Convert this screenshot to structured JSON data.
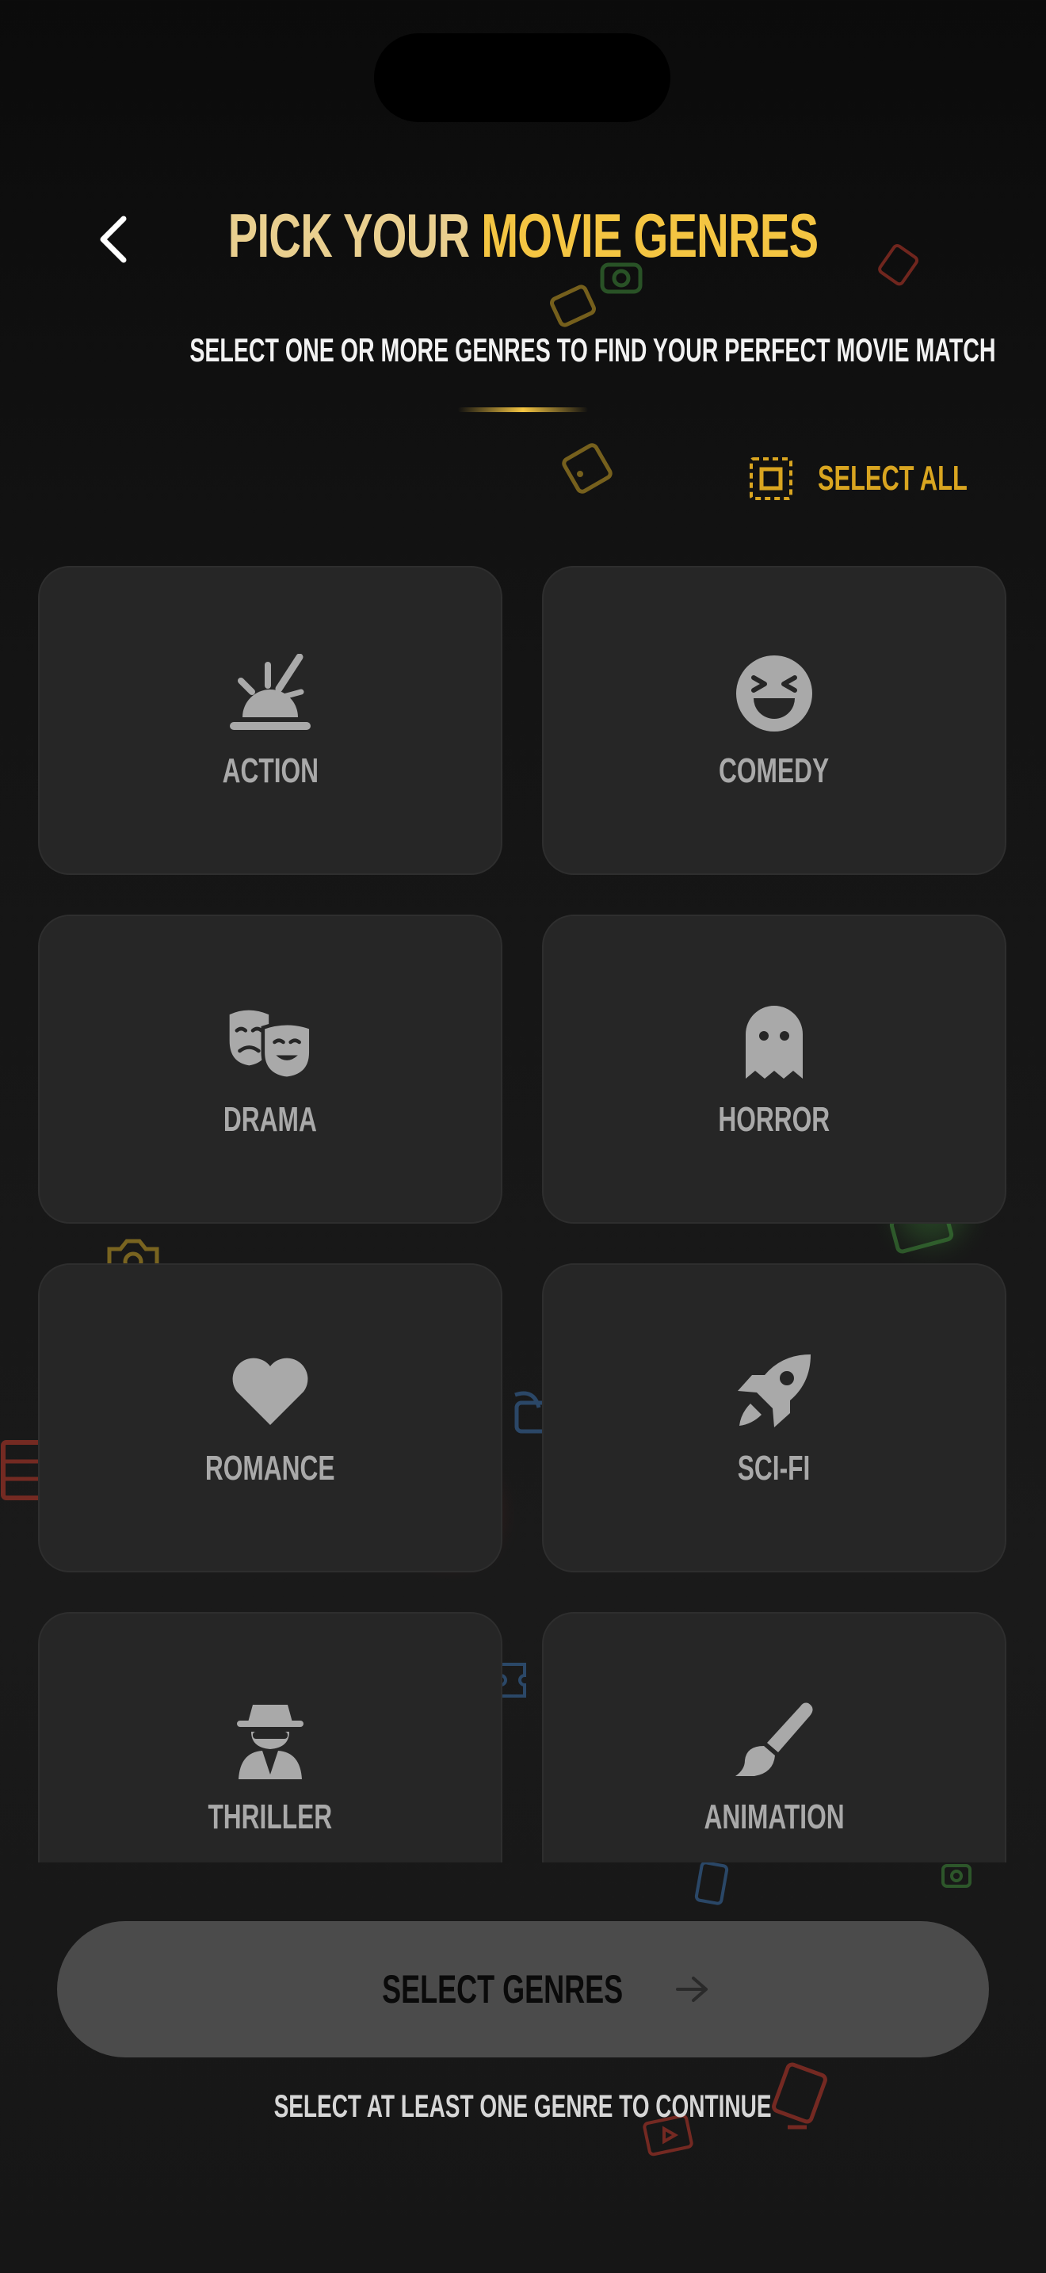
{
  "header": {
    "title_part1": "PICK YOUR ",
    "title_part2": "MOVIE GENRES",
    "subtitle": "SELECT ONE OR MORE GENRES TO FIND YOUR PERFECT MOVIE MATCH",
    "back_icon": "chevron-left-icon"
  },
  "select_all": {
    "label": "SELECT ALL",
    "icon": "select-all-icon"
  },
  "genres": [
    {
      "label": "ACTION",
      "icon": "explosion-icon"
    },
    {
      "label": "COMEDY",
      "icon": "laughing-face-icon"
    },
    {
      "label": "DRAMA",
      "icon": "theater-masks-icon"
    },
    {
      "label": "HORROR",
      "icon": "ghost-icon"
    },
    {
      "label": "ROMANCE",
      "icon": "heart-icon"
    },
    {
      "label": "SCI-FI",
      "icon": "rocket-icon"
    },
    {
      "label": "THRILLER",
      "icon": "spy-icon"
    },
    {
      "label": "ANIMATION",
      "icon": "paintbrush-icon"
    }
  ],
  "cta": {
    "label": "SELECT GENRES",
    "icon": "arrow-right-icon"
  },
  "hint": "SELECT AT LEAST ONE GENRE TO CONTINUE",
  "colors": {
    "accent": "#f4c542",
    "accent_light": "#e9cf8f",
    "card_bg": "#262626",
    "card_label": "#a9a9a9",
    "cta_bg": "#4b4b4b"
  }
}
